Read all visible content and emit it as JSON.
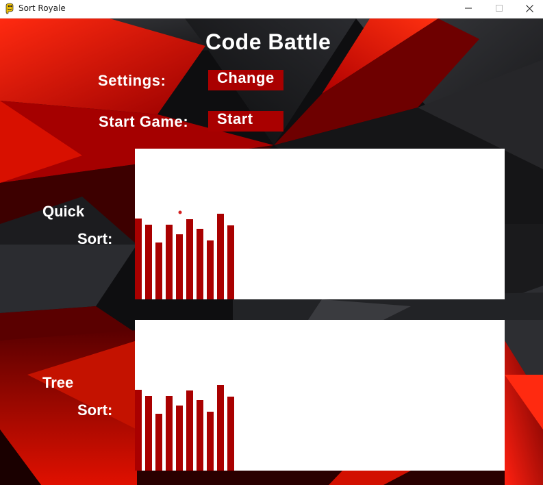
{
  "window": {
    "title": "Sort Royale",
    "controls": [
      "minimize",
      "maximize",
      "close"
    ]
  },
  "game": {
    "title": "Code Battle",
    "settings_label": "Settings:",
    "change_button": "Change",
    "start_game_label": "Start Game:",
    "start_button": "Start"
  },
  "colors": {
    "bar": "#a90000",
    "panel": "#ffffff",
    "button": "#a90000",
    "pivot_marker": "#d42020"
  },
  "algorithms": [
    {
      "label_line1": "Quick",
      "label_line2": "Sort:",
      "bar_values": [
        118,
        109,
        83,
        109,
        95,
        117,
        103,
        86,
        125,
        108
      ],
      "max_value": 220,
      "marker_index": 4,
      "marker_value": 127
    },
    {
      "label_line1": "Tree",
      "label_line2": "Sort:",
      "bar_values": [
        118,
        109,
        83,
        109,
        95,
        117,
        103,
        86,
        125,
        108
      ],
      "max_value": 220
    }
  ]
}
